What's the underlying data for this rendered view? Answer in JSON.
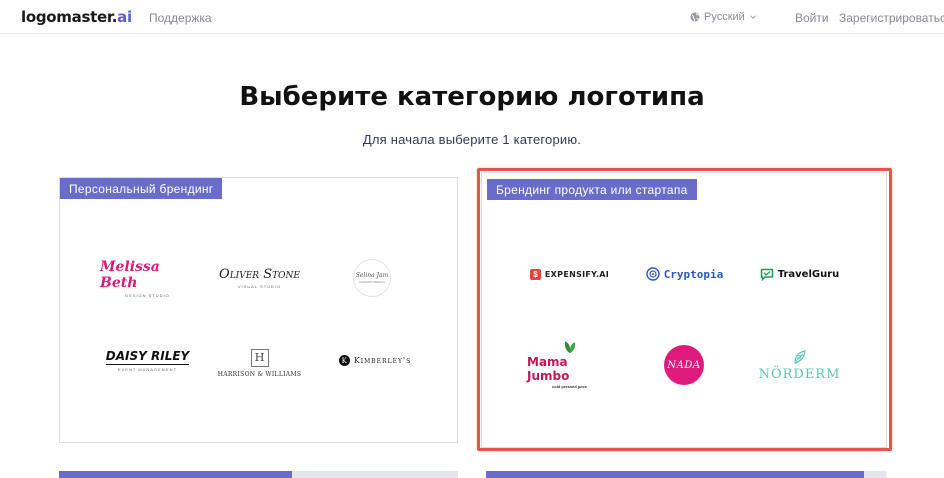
{
  "header": {
    "logo_main": "logomaster.",
    "logo_ai": "ai",
    "support": "Поддержка",
    "language": "Русский",
    "login": "Войти",
    "register": "Зарегистрироваться"
  },
  "main": {
    "title": "Выберите категорию логотипа",
    "subtitle": "Для начала выберите 1 категорию."
  },
  "categories": {
    "personal": {
      "label": "Персональный брендинг",
      "logos": [
        {
          "name": "Melissa Beth",
          "sub": "DESIGN STUDIO"
        },
        {
          "name": "Oliver Stone",
          "sub": "VISUAL STUDIO"
        },
        {
          "name": "Selina Jam",
          "sub": "FASHION DESIGN"
        },
        {
          "name": "DAISY RILEY",
          "sub": "EVENT MANAGEMENT"
        },
        {
          "name": "HARRISON & WILLIAMS",
          "letter": "H"
        },
        {
          "name": "Kimberley's",
          "letter": "K"
        }
      ]
    },
    "product": {
      "label": "Брендинг продукта или стартапа",
      "logos": [
        {
          "name": "EXPENSIFY.AI",
          "letter": "$"
        },
        {
          "name": "Cryptopia"
        },
        {
          "name": "TravelGuru"
        },
        {
          "name": "Mama Jumbo",
          "sub": "cold pressed juice"
        },
        {
          "name": "NADA"
        },
        {
          "name": "NÖRDERM"
        }
      ]
    }
  },
  "colors": {
    "accent": "#6a6ccc",
    "highlight": "#e2574c",
    "logo_ai": "#5a5fc9"
  }
}
